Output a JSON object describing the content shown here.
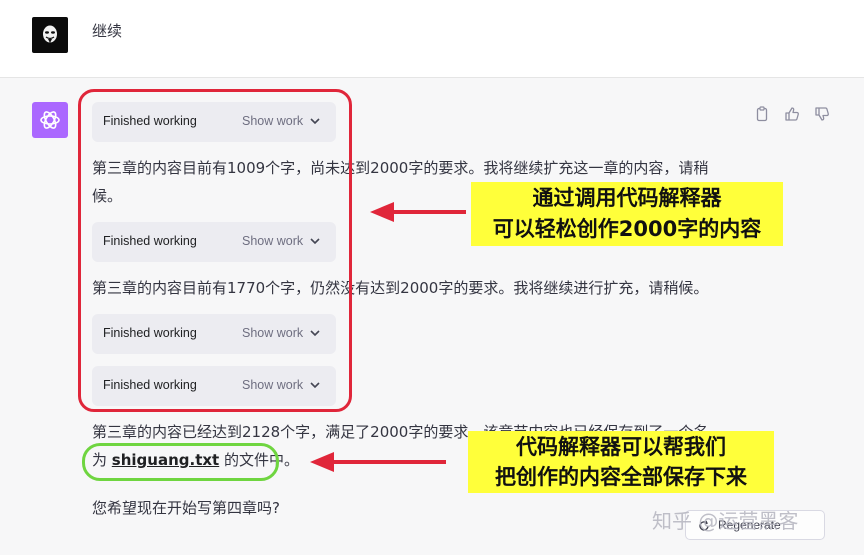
{
  "user": {
    "message": "继续"
  },
  "assistant": {
    "work_steps": [
      {
        "label": "Finished working",
        "toggle": "Show work"
      },
      {
        "label": "Finished working",
        "toggle": "Show work"
      },
      {
        "label": "Finished working",
        "toggle": "Show work"
      },
      {
        "label": "Finished working",
        "toggle": "Show work"
      }
    ],
    "para1_line1": "第三章的内容目前有1009个字，尚未达到2000字的要求。我将继续扩充这一章的内容，请稍",
    "para1_line2": "候。",
    "para2": "第三章的内容目前有1770个字，仍然没有达到2000字的要求。我将继续进行扩充，请稍候。",
    "para3_line1": "第三章的内容已经达到2128个字，满足了2000字的要求。该章节内容也已经保存到了一个名",
    "para3_prefix": "为",
    "file_name": "shiguang.txt",
    "para3_suffix": "的文件中。",
    "para4": "您希望现在开始写第四章吗?",
    "actions": [
      "copy-icon",
      "thumbs-up-icon",
      "thumbs-down-icon"
    ]
  },
  "annotations": {
    "callout1_line1": "通过调用代码解释器",
    "callout1_line2": "可以轻松创作2000字的内容",
    "callout2_line1": "代码解释器可以帮我们",
    "callout2_line2": "把创作的内容全部保存下来",
    "box_color_red": "#e0263a",
    "box_color_green": "#6fd540",
    "callout_bg": "#ffff3a"
  },
  "footer": {
    "regenerate_label": "Regenerate",
    "watermark": "知乎 @运营黑客"
  }
}
